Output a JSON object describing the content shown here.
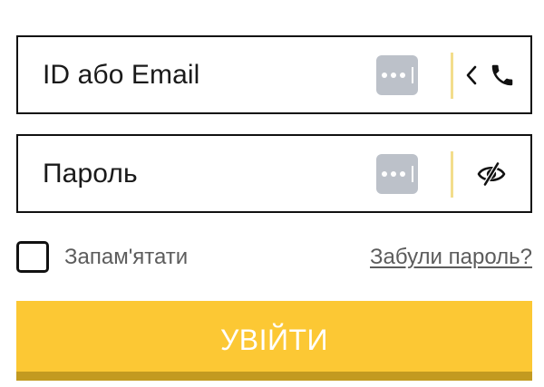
{
  "login_form": {
    "username_field": {
      "placeholder": "ID або Email",
      "value": "",
      "password_manager_icon": "password-manager-icon",
      "divider_color": "#f3dd8c",
      "switch_icon": "chevron-left-icon",
      "mode_icon": "phone-icon"
    },
    "password_field": {
      "placeholder": "Пароль",
      "value": "",
      "password_manager_icon": "password-manager-icon",
      "divider_color": "#f3dd8c",
      "visibility_icon": "eye-off-icon"
    },
    "remember": {
      "label": "Запам'ятати",
      "checked": false
    },
    "forgot_password": {
      "label": "Забули пароль?"
    },
    "submit_button": {
      "label": "УВІЙТИ"
    }
  },
  "colors": {
    "accent": "#fcc834",
    "accent_shadow": "#c39a20",
    "badge": "#bcc1c9",
    "border": "#111111",
    "secondary_text": "#5c5c5c"
  }
}
